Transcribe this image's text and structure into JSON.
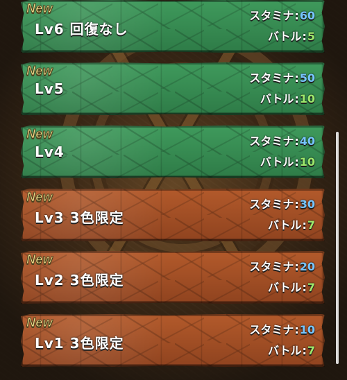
{
  "stages": [
    {
      "badge": "New",
      "name": "Lv6 回復なし",
      "stamina_label": "スタミナ",
      "stamina_value": "60",
      "battle_label": "バトル",
      "battle_value": "5",
      "theme": "green"
    },
    {
      "badge": "New",
      "name": "Lv5",
      "stamina_label": "スタミナ",
      "stamina_value": "50",
      "battle_label": "バトル",
      "battle_value": "10",
      "theme": "green"
    },
    {
      "badge": "New",
      "name": "Lv4",
      "stamina_label": "スタミナ",
      "stamina_value": "40",
      "battle_label": "バトル",
      "battle_value": "10",
      "theme": "green"
    },
    {
      "badge": "New",
      "name": "Lv3 3色限定",
      "stamina_label": "スタミナ",
      "stamina_value": "30",
      "battle_label": "バトル",
      "battle_value": "7",
      "theme": "brown"
    },
    {
      "badge": "New",
      "name": "Lv2 3色限定",
      "stamina_label": "スタミナ",
      "stamina_value": "20",
      "battle_label": "バトル",
      "battle_value": "7",
      "theme": "brown"
    },
    {
      "badge": "New",
      "name": "Lv1 3色限定",
      "stamina_label": "スタミナ",
      "stamina_value": "10",
      "battle_label": "バトル",
      "battle_value": "7",
      "theme": "brown"
    }
  ],
  "colors": {
    "green_card": "#2e7b47",
    "brown_card": "#8f431f",
    "badge": "#f1de8c",
    "stamina_value": "#76c5ff",
    "battle_value": "#9ee86b"
  }
}
